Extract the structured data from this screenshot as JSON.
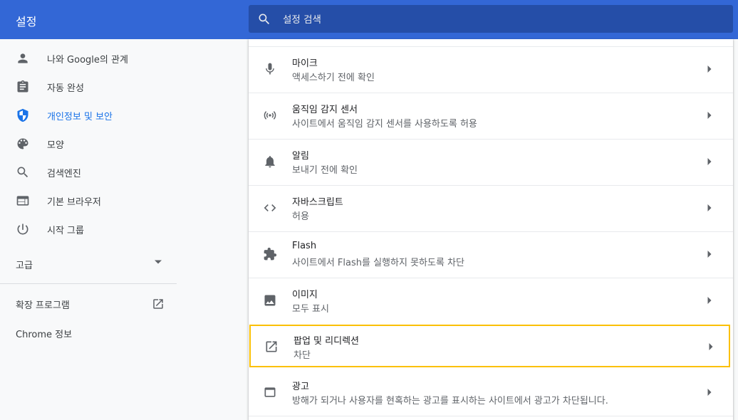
{
  "header": {
    "title": "설정",
    "search_placeholder": "설정 검색"
  },
  "sidebar": {
    "items": [
      {
        "label": "나와 Google의 관계",
        "icon": "person-icon"
      },
      {
        "label": "자동 완성",
        "icon": "clipboard-icon"
      },
      {
        "label": "개인정보 및 보안",
        "icon": "shield-icon",
        "active": true
      },
      {
        "label": "모양",
        "icon": "palette-icon"
      },
      {
        "label": "검색엔진",
        "icon": "search-icon"
      },
      {
        "label": "기본 브라우저",
        "icon": "browser-icon"
      },
      {
        "label": "시작 그룹",
        "icon": "power-icon"
      }
    ],
    "advanced_label": "고급",
    "extensions_label": "확장 프로그램",
    "about_label": "Chrome 정보"
  },
  "settings": {
    "rows": [
      {
        "title": "마이크",
        "subtitle": "액세스하기 전에 확인",
        "icon": "microphone-icon"
      },
      {
        "title": "움직임 감지 센서",
        "subtitle": "사이트에서 움직임 감지 센서를 사용하도록 허용",
        "icon": "sensors-icon"
      },
      {
        "title": "알림",
        "subtitle": "보내기 전에 확인",
        "icon": "bell-icon"
      },
      {
        "title": "자바스크립트",
        "subtitle": "허용",
        "icon": "code-icon"
      },
      {
        "title": "Flash",
        "subtitle": "사이트에서 Flash를 실행하지 못하도록 차단",
        "icon": "puzzle-icon"
      },
      {
        "title": "이미지",
        "subtitle": "모두 표시",
        "icon": "image-icon"
      },
      {
        "title": "팝업 및 리디렉션",
        "subtitle": "차단",
        "icon": "open-external-icon",
        "highlighted": true
      },
      {
        "title": "광고",
        "subtitle": "방해가 되거나 사용자를 현혹하는 광고를 표시하는 사이트에서 광고가 차단됩니다.",
        "icon": "ads-window-icon"
      }
    ]
  },
  "colors": {
    "header": "#3367d6",
    "search_bg": "#254ea8",
    "active": "#1a73e8",
    "highlight_border": "#fbc000"
  }
}
